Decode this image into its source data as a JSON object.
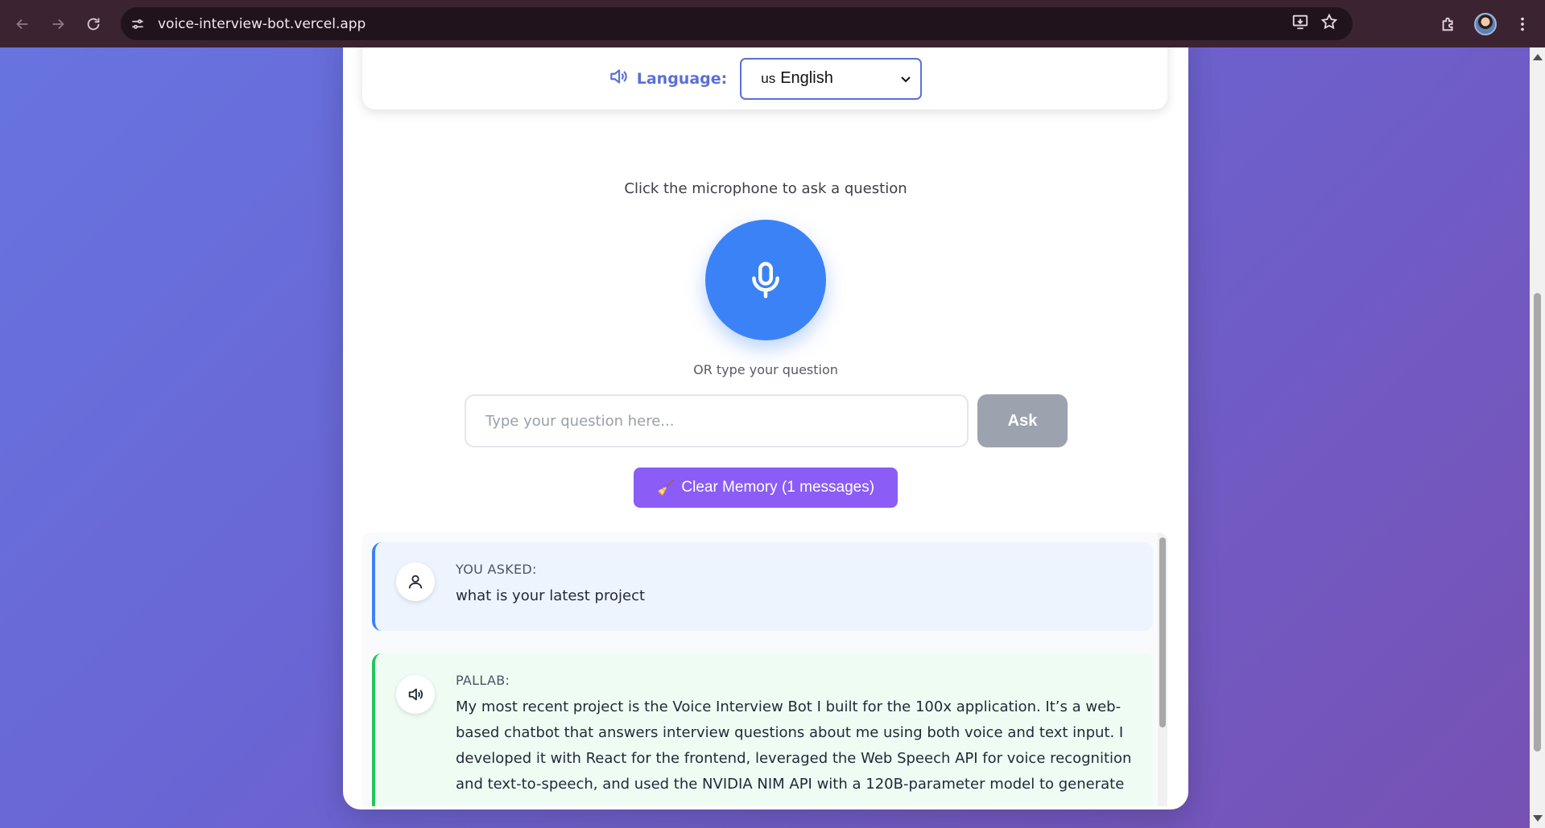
{
  "browser": {
    "url": "voice-interview-bot.vercel.app",
    "icons": [
      "back-icon",
      "forward-icon",
      "reload-icon",
      "site-info-icon",
      "install-app-icon",
      "star-icon",
      "extensions-icon",
      "profile-avatar",
      "menu-icon"
    ]
  },
  "language": {
    "label": "Language:",
    "selected_flag": "us",
    "selected": "English"
  },
  "voice": {
    "prompt": "Click the microphone to ask a question",
    "or_text": "OR type your question"
  },
  "input": {
    "placeholder": "Type your question here...",
    "value": ""
  },
  "ask_label": "Ask",
  "clear": {
    "icon": "🧹",
    "label": "Clear Memory (1 messages)"
  },
  "messages": [
    {
      "role": "user",
      "who": "YOU ASKED:",
      "text": "what is your latest project"
    },
    {
      "role": "bot",
      "who": "PALLAB:",
      "text": "My most recent project is the Voice Interview Bot I built for the 100x application. It’s a web-based chatbot that answers interview questions about me using both voice and text input. I developed it with React for the frontend, leveraged the Web Speech API for voice recognition and text-to-speech, and used the NVIDIA NIM API with a 120B-parameter model to generate"
    }
  ],
  "colors": {
    "accent_blue": "#3b82f6",
    "accent_purple": "#8b5cf6",
    "bot_green": "#22c55e",
    "ask_disabled": "#9ca3af"
  }
}
